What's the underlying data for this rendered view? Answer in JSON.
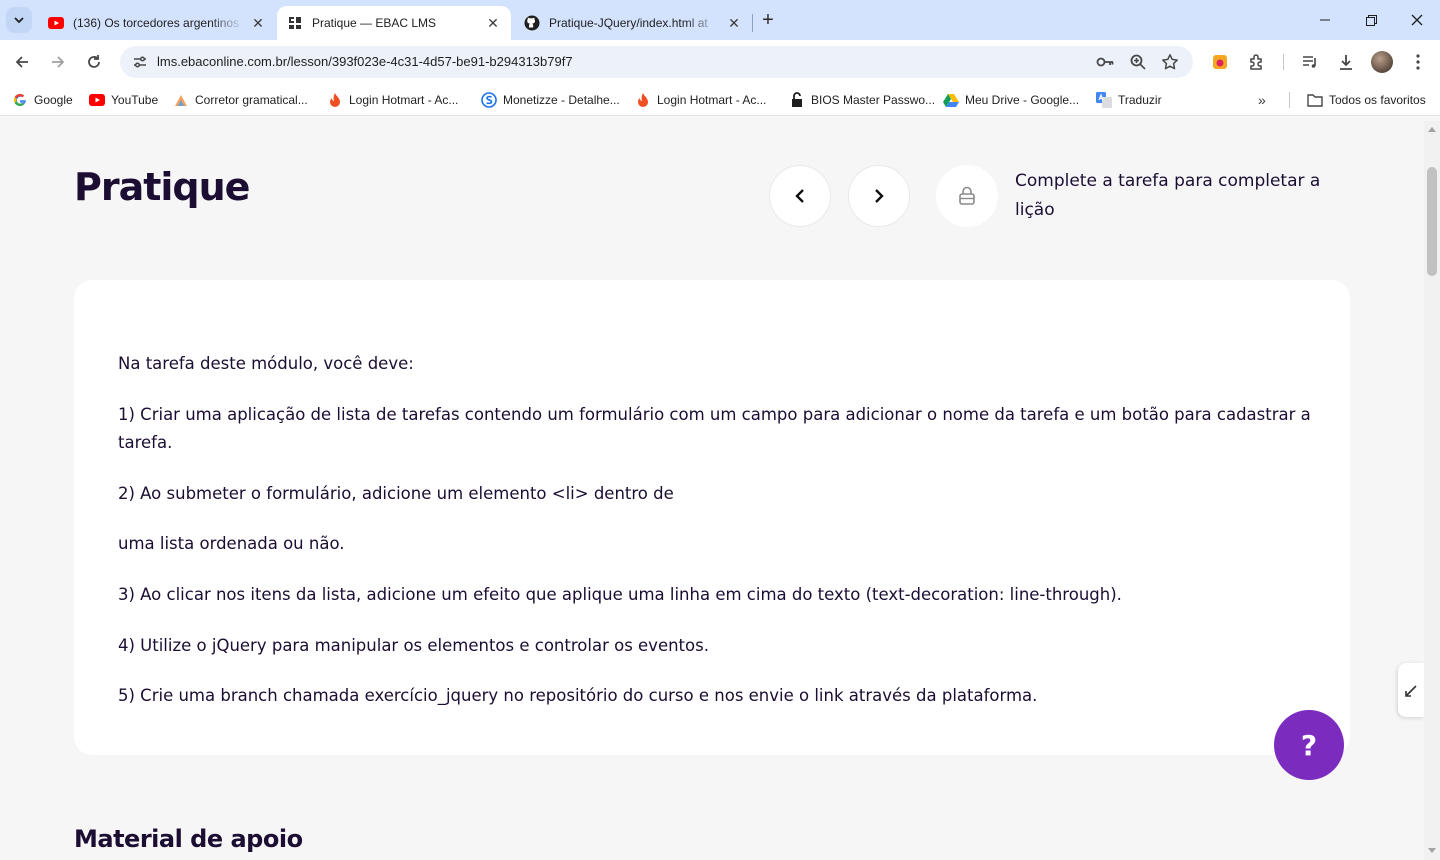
{
  "browser": {
    "tabs": [
      {
        "title": "(136) Os torcedores argentinos",
        "icon": "youtube-icon",
        "active": false
      },
      {
        "title": "Pratique — EBAC LMS",
        "icon": "ebac-icon",
        "active": true
      },
      {
        "title": "Pratique-JQuery/index.html at",
        "icon": "github-icon",
        "active": false
      }
    ],
    "new_tab_label": "+",
    "url": "lms.ebaconline.com.br/lesson/393f023e-4c31-4d57-be91-b294313b79f7",
    "bookmarks": [
      {
        "label": "Google",
        "icon": "google-icon"
      },
      {
        "label": "YouTube",
        "icon": "youtube-icon"
      },
      {
        "label": "Corretor gramatical...",
        "icon": "corretor-icon"
      },
      {
        "label": "Login Hotmart - Ac...",
        "icon": "hotmart-icon"
      },
      {
        "label": "Monetizze - Detalhe...",
        "icon": "monetizze-icon"
      },
      {
        "label": "Login Hotmart - Ac...",
        "icon": "hotmart-icon"
      },
      {
        "label": "BIOS Master Passwo...",
        "icon": "lock-open-icon"
      },
      {
        "label": "Meu Drive - Google...",
        "icon": "google-drive-icon"
      },
      {
        "label": "Traduzir",
        "icon": "google-translate-icon"
      }
    ],
    "bookmarks_more": "»",
    "all_bookmarks": "Todos os favoritos"
  },
  "page": {
    "title": "Pratique",
    "lesson_hint": "Complete a tarefa para completar a lição",
    "instructions": [
      "Na tarefa deste módulo, você deve:",
      "1) Criar uma aplicação de lista de tarefas contendo um formulário com um campo para adicionar o nome da tarefa e um botão para cadastrar a tarefa.",
      "2) Ao submeter o formulário, adicione um elemento <li> dentro de",
      "uma lista ordenada ou não.",
      "3) Ao clicar nos itens da lista, adicione um efeito que aplique uma linha em cima do texto (text-decoration: line-through).",
      "4) Utilize o jQuery para manipular os elementos e controlar os eventos.",
      "5) Crie uma branch chamada exercício_jquery no repositório do curso e nos envie o link através da plataforma."
    ],
    "section_title": "Material de apoio",
    "help_label": "?"
  },
  "colors": {
    "brand_purple": "#7b2cbf",
    "text_dark": "#1c0d33",
    "tabstrip": "#d3e3fd"
  }
}
